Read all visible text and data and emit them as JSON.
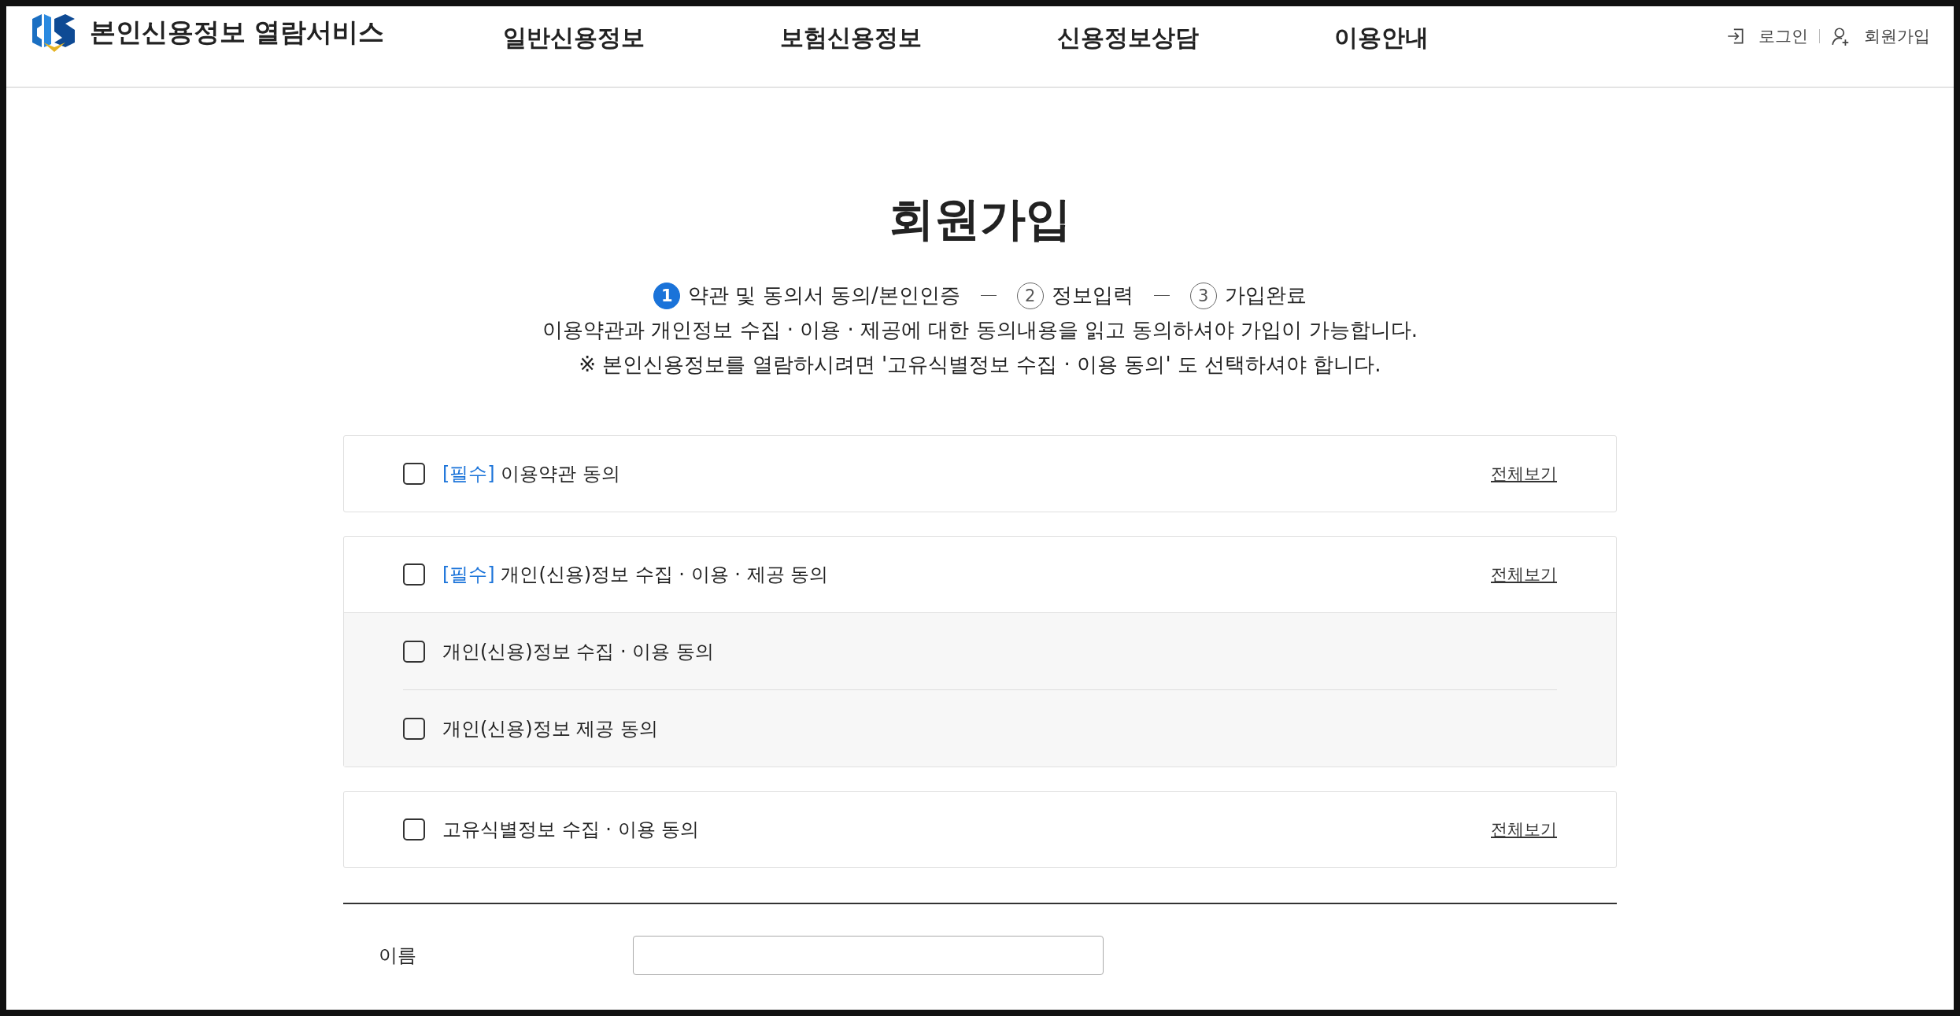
{
  "header": {
    "logo_text": "본인신용정보 열람서비스",
    "nav": [
      {
        "label": "일반신용정보"
      },
      {
        "label": "보험신용정보"
      },
      {
        "label": "신용정보상담"
      },
      {
        "label": "이용안내"
      }
    ],
    "auth": [
      {
        "kind": "login",
        "label": "로그인"
      },
      {
        "kind": "join",
        "label": "회원가입"
      }
    ]
  },
  "title": "회원가입",
  "steps": [
    {
      "number": "1",
      "label": "약관 및 동의서 동의/본인인증",
      "selected": true
    },
    {
      "number": "2",
      "label": "정보입력",
      "selected": false
    },
    {
      "number": "3",
      "label": "가입완료",
      "selected": false
    }
  ],
  "notices": [
    "이용약관과 개인정보 수집 · 이용 · 제공에 대한 동의내용을 읽고 동의하셔야 가입이 가능합니다.",
    "※ 본인신용정보를 열람하시려면 '고유식별정보 수집 · 이용 동의' 도 선택하셔야 합니다."
  ],
  "agreements": [
    {
      "tag": "[필수]",
      "label": "이용약관 동의",
      "checked": false,
      "view_label": "전체보기"
    },
    {
      "tag": "[필수]",
      "label": "개인(신용)정보 수집 · 이용 · 제공 동의",
      "checked": false,
      "view_label": "전체보기",
      "children": [
        {
          "label": "개인(신용)정보 수집 · 이용 동의",
          "checked": false
        },
        {
          "label": "개인(신용)정보 제공 동의",
          "checked": false
        }
      ]
    },
    {
      "label": "고유식별정보 수집 · 이용 동의",
      "checked": false,
      "view_label": "전체보기"
    }
  ],
  "name_field": {
    "label": "이름"
  }
}
